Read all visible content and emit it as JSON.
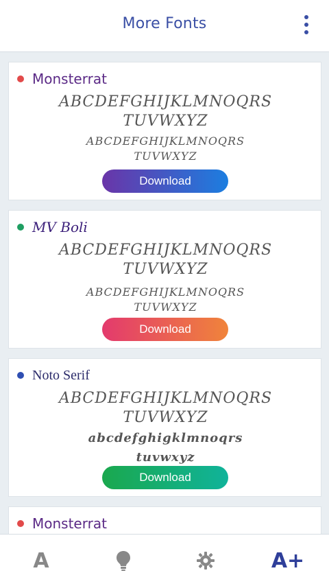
{
  "header": {
    "title": "More Fonts"
  },
  "cards": [
    {
      "name": "Monsterrat",
      "dot_color": "#e24a4a",
      "sample_upper_line1": "ABCDEFGHIJKLMNOQRS",
      "sample_upper_line2": "TUVWXYZ",
      "sample_small_line1": "ABCDEFGHIJKLMNOQRS",
      "sample_small_line2": "TUVWXYZ",
      "button": "Download"
    },
    {
      "name": "MV Boli",
      "dot_color": "#1f9e62",
      "sample_upper_line1": "ABCDEFGHIJKLMNOQRS",
      "sample_upper_line2": "TUVWXYZ",
      "sample_small_line1": "ABCDEFGHIJKLMNOQRS",
      "sample_small_line2": "TUVWXYZ",
      "button": "Download"
    },
    {
      "name": "Noto Serif",
      "dot_color": "#2f4fb2",
      "sample_upper_line1": "ABCDEFGHIJKLMNOQRS",
      "sample_upper_line2": "TUVWXYZ",
      "sample_lower_line1": "abcdefghigklmnoqrs",
      "sample_lower_line2": "tuvwxyz",
      "button": "Download"
    },
    {
      "name": "Monsterrat",
      "dot_color": "#e24a4a"
    }
  ],
  "nav": {
    "a_label": "A",
    "aplus_label": "A+"
  },
  "colors": {
    "accent": "#3a4fa5",
    "nav_inactive": "#888888"
  },
  "icons": {
    "menu": "kebab-menu-icon",
    "nav_a": "font-a-icon",
    "nav_bulb": "lightbulb-icon",
    "nav_gear": "gear-icon",
    "nav_aplus": "font-plus-icon"
  }
}
